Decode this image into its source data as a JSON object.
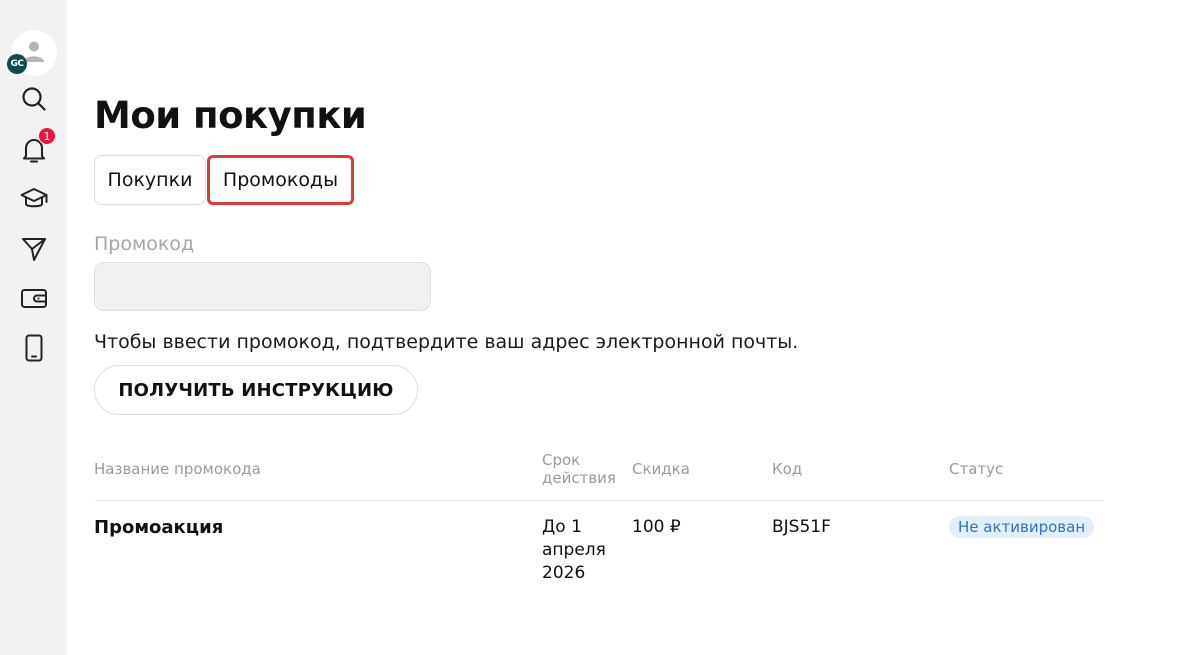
{
  "sidebar": {
    "avatar_initials": "GC",
    "notifications_count": "1",
    "items": [
      {
        "name": "search-icon"
      },
      {
        "name": "bell-icon"
      },
      {
        "name": "graduation-cap-icon"
      },
      {
        "name": "paper-plane-icon"
      },
      {
        "name": "wallet-icon"
      },
      {
        "name": "phone-icon"
      }
    ]
  },
  "page": {
    "title": "Мои покупки"
  },
  "tabs": [
    {
      "label": "Покупки",
      "active": false
    },
    {
      "label": "Промокоды",
      "active": true
    }
  ],
  "promo_form": {
    "label": "Промокод",
    "value": "",
    "placeholder": "",
    "hint": "Чтобы ввести промокод, подтвердите ваш адрес электронной почты.",
    "button_label": "ПОЛУЧИТЬ ИНСТРУКЦИЮ"
  },
  "table": {
    "headers": {
      "name": "Название промокода",
      "validity_line1": "Срок",
      "validity_line2": "действия",
      "discount": "Скидка",
      "code": "Код",
      "status": "Статус"
    },
    "rows": [
      {
        "name": "Промоакция",
        "validity_line1": "До 1",
        "validity_line2": "апреля",
        "validity_line3": "2026",
        "discount": "100 ₽",
        "code": "BJS51F",
        "status": "Не активирован"
      }
    ]
  },
  "colors": {
    "accent_red": "#e0393a",
    "badge_red": "#e8173f",
    "status_blue": "#2e73c8",
    "status_bg": "#e3eefb",
    "avatar_badge": "#124b4f"
  }
}
